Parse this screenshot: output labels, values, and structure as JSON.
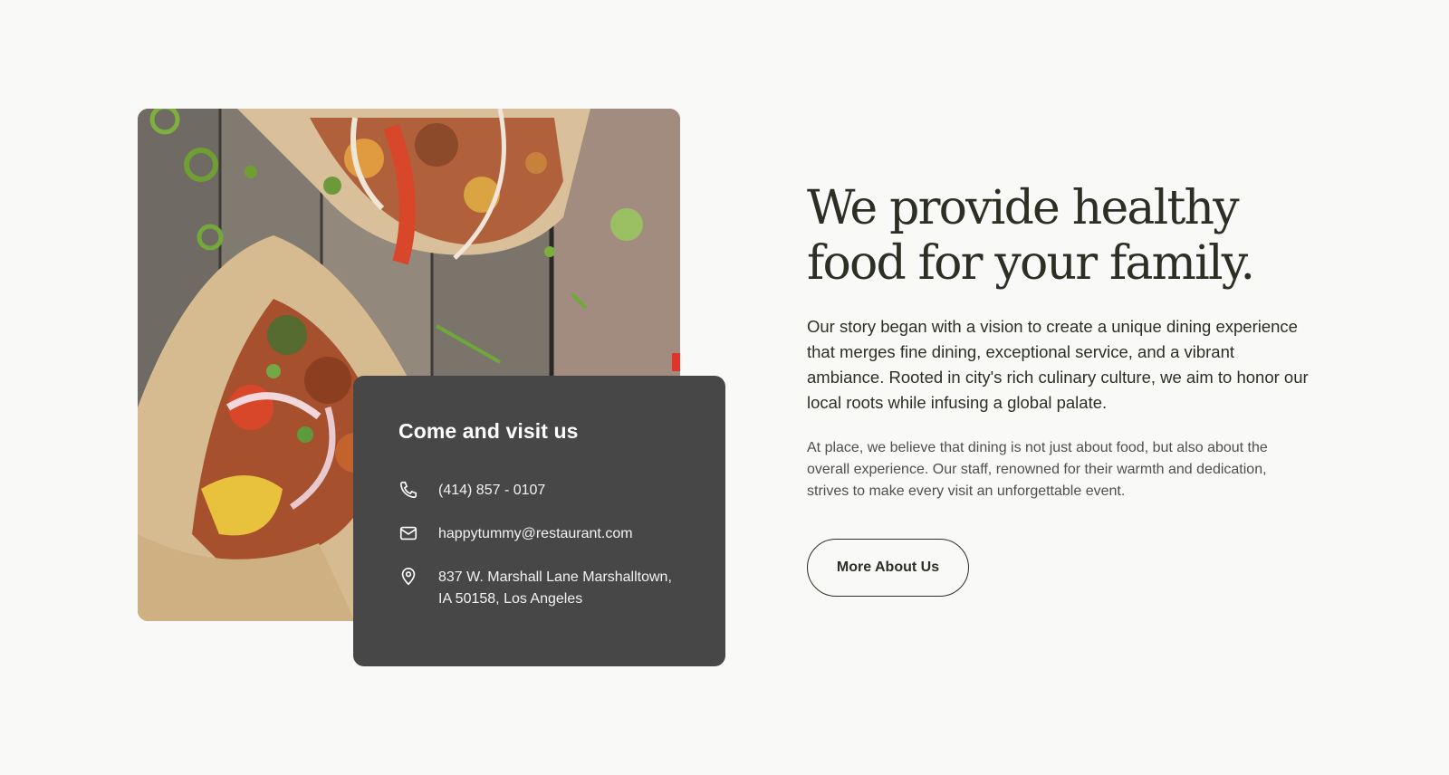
{
  "colors": {
    "background": "#f9f9f7",
    "card": "#474747",
    "heading": "#2c2f24",
    "body_text": "#4f4f4f"
  },
  "image": {
    "description_icon": "food-photo"
  },
  "contact_card": {
    "title": "Come and visit us",
    "phone": {
      "icon": "phone-icon",
      "text": "(414) 857 - 0107"
    },
    "email": {
      "icon": "mail-icon",
      "text": "happytummy@restaurant.com"
    },
    "address": {
      "icon": "location-pin-icon",
      "line1": "837 W. Marshall Lane Marshalltown,",
      "line2": "IA 50158, Los Angeles"
    }
  },
  "about": {
    "headline_line1": "We provide healthy",
    "headline_line2": "food for your family.",
    "lead": "Our story began with a vision to create a unique dining experience that merges fine dining, exceptional service, and a vibrant ambiance. Rooted in city's rich culinary culture, we aim to honor our local roots while infusing a global palate.",
    "body": "At place, we believe that dining is not just about food, but also about the overall experience. Our staff, renowned for their warmth and dedication, strives to make every visit an unforgettable event.",
    "button_label": "More About Us"
  }
}
